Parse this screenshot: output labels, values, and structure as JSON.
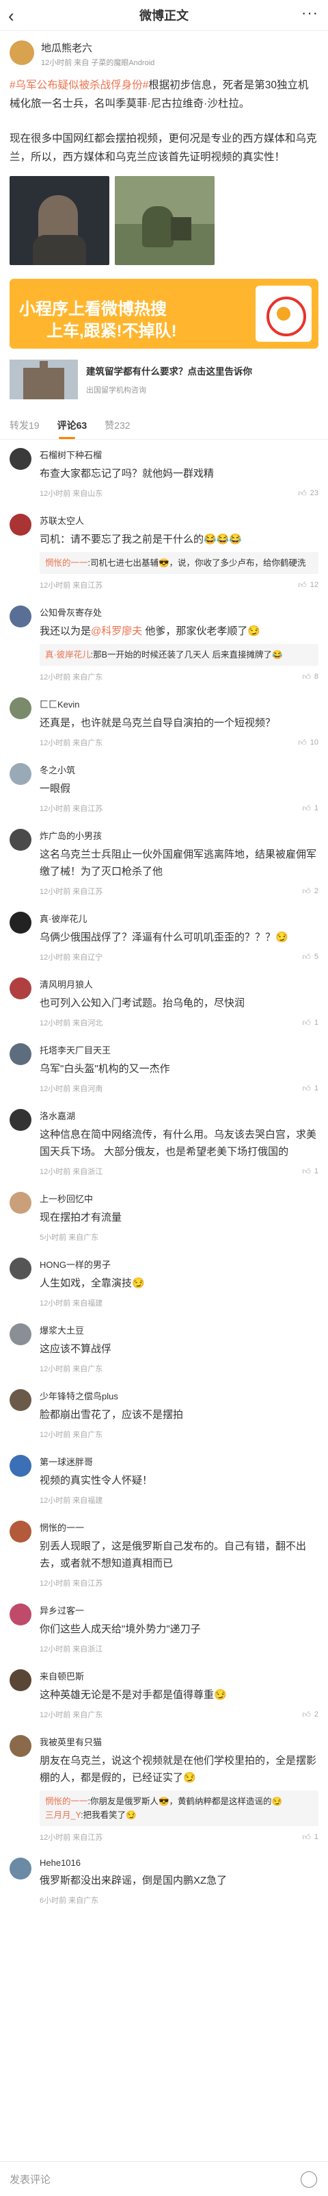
{
  "header": {
    "title": "微博正文",
    "back_icon": "chevron-left-icon",
    "more_icon": "more-dots-icon"
  },
  "post": {
    "author": "地瓜熊老六",
    "time": "12小时前 来自 子菜的魔眼Android",
    "topic": "#乌军公布疑似被杀战俘身份#",
    "text1": "根据初步信息，死者是第30独立机械化旅一名士兵，名叫季莫菲·尼古拉维奇·沙杜拉。",
    "text2": "现在很多中国网红都会摆拍视频，更何况是专业的西方媒体和乌克兰，所以，西方媒体和乌克兰应该首先证明视频的真实性！"
  },
  "ad1": {
    "line1": "小程序上看微博热搜",
    "line2": "上车,跟紧!不掉队!"
  },
  "ad2": {
    "title": "建筑留学都有什么要求？点击这里告诉你",
    "sub": "出国留学机构咨询"
  },
  "tabs": {
    "repost": "转发19",
    "comment": "评论63",
    "like": "赞232"
  },
  "comments": [
    {
      "user": "石榴树下种石榴",
      "text": "布查大家都忘记了吗？就他妈一群戏精",
      "time": "12小时前 来自山东",
      "likes": "23"
    },
    {
      "user": "苏联太空人",
      "text": "司机：请不要忘了我之前是干什么的😂😂😂",
      "reply_name": "惘怅的一一",
      "reply_text": ":司机七进七出基辅😎，说，你收了多少卢布，给你鹤硬洗",
      "time": "12小时前 来自江苏",
      "likes": "12"
    },
    {
      "user": "公知骨灰寄存处",
      "text_pre": "我还以为是",
      "text_link": "@科罗廖夫",
      "text_post": " 他爹，那家伙老孝顺了😏",
      "reply_name": "真·彼岸花儿",
      "reply_text": ":那B一开始的时候还装了几天人 后来直接摊牌了😂",
      "time": "12小时前 来自广东",
      "likes": "8"
    },
    {
      "user": "匚匚Kevin",
      "text": "还真是，也许就是乌克兰自导自演拍的一个短视频？",
      "time": "12小时前 来自广东",
      "likes": "10"
    },
    {
      "user": "冬之小筑",
      "text": "一眼假",
      "time": "12小时前 来自江苏",
      "likes": "1"
    },
    {
      "user": "炸广岛的小男孩",
      "text": "这名乌克兰士兵阻止一伙外国雇佣军逃离阵地，结果被雇佣军缴了械！为了灭口枪杀了他",
      "time": "12小时前 来自江苏",
      "likes": "2"
    },
    {
      "user": "真·彼岸花儿",
      "text": "乌俩少俄围战俘了？泽逼有什么可叽叽歪歪的？？？😏",
      "time": "12小时前 来自辽宁",
      "likes": "5"
    },
    {
      "user": "清风明月狼人",
      "text": "也可列入公知入门考试题。抬乌龟的，尽快润",
      "time": "12小时前 来自河北",
      "likes": "1"
    },
    {
      "user": "托塔李天厂目天王",
      "text": "乌军\"白头盔\"机构的又一杰作",
      "time": "12小时前 来自河南",
      "likes": "1"
    },
    {
      "user": "洛水嘉湖",
      "text": "这种信息在简中网络流传，有什么用。乌友该去哭白宫，求美国天兵下场。 大部分俄友，也是希望老美下场打俄国的",
      "time": "12小时前 来自浙江",
      "likes": "1"
    },
    {
      "user": "上一秒回忆中",
      "text": "现在摆拍才有流量",
      "time": "5小时前 来自广东",
      "likes": ""
    },
    {
      "user": "HONG一样的男子",
      "text": "人生如戏，全靠演技😏",
      "time": "12小时前 来自福建",
      "likes": ""
    },
    {
      "user": "爆浆大土豆",
      "text": "这应该不算战俘",
      "time": "12小时前 来自广东",
      "likes": ""
    },
    {
      "user": "少年锋特之偿鸟plus",
      "text": "脸都崩出雪花了，应该不是摆拍",
      "time": "12小时前 来自广东",
      "likes": ""
    },
    {
      "user": "第一球迷胖哥",
      "text": "视频的真实性令人怀疑！",
      "time": "12小时前 来自福建",
      "likes": ""
    },
    {
      "user": "惘怅的一一",
      "text": "别丢人现眼了，这是俄罗斯自己发布的。自己有错，翻不出去，或者就不想知道真相而已",
      "time": "12小时前 来自江苏",
      "likes": ""
    },
    {
      "user": "异乡过客一",
      "text": "你们这些人成天给\"境外势力\"递刀子",
      "time": "12小时前 来自浙江",
      "likes": ""
    },
    {
      "user": "来自顿巴斯",
      "text": "这种英雄无论是不是对手都是值得尊重😏",
      "time": "12小时前 来自广东",
      "likes": "2"
    },
    {
      "user": "我被英里有只猫",
      "text": "朋友在乌克兰，说这个视频就是在他们学校里拍的，全是摆影棚的人，都是假的，已经证实了😏",
      "reply_name": "惘怅的一一",
      "reply_text": ":你朋友是俄罗斯人😎，黄鹤纳粹都是这样造谣的😏",
      "reply2_name": "三月月_Y",
      "reply2_text": ":把我看笑了😏",
      "time": "12小时前 来自江苏",
      "likes": "1"
    },
    {
      "user": "Hehe1016",
      "text": "俄罗斯都没出来辟谣，倒是国内鹏XZ急了",
      "time": "6小时前 来自广东",
      "likes": ""
    }
  ],
  "bottom": {
    "placeholder": "发表评论"
  }
}
